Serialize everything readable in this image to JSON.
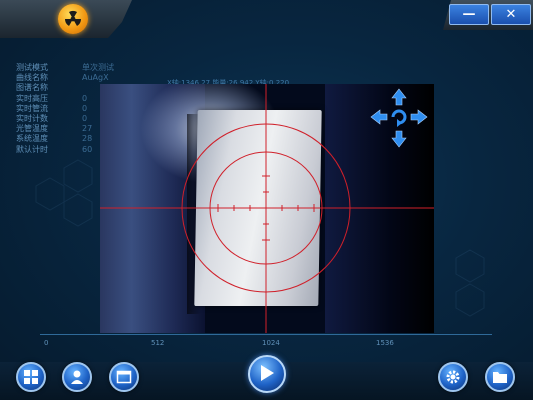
{
  "info_panel": [
    {
      "label": "测试模式",
      "value": "单次测试"
    },
    {
      "label": "曲线名称",
      "value": "AuAgX"
    },
    {
      "label": "图谱名称",
      "value": ""
    },
    {
      "label": "实时高压",
      "value": "0"
    },
    {
      "label": "实时管流",
      "value": "0"
    },
    {
      "label": "实时计数",
      "value": "0"
    },
    {
      "label": "光管温度",
      "value": "27"
    },
    {
      "label": "系统温度",
      "value": "28"
    },
    {
      "label": "默认计时",
      "value": "60"
    }
  ],
  "coordinate_readout": "X轴:1346.27  能量:26.942  Y轴:0.220",
  "scale": {
    "ticks": [
      "0",
      "512",
      "1024",
      "1536"
    ]
  },
  "window_buttons": {
    "minimize": "—",
    "close": "✕"
  },
  "icons": {
    "logo": "radiation-icon",
    "arrows": [
      "arrow-up-icon",
      "arrow-left-icon",
      "rotate-icon",
      "arrow-right-icon",
      "arrow-down-icon"
    ],
    "bottom": [
      "windows-icon",
      "user-icon",
      "window-icon",
      "play-icon",
      "settings-icon",
      "folder-icon"
    ]
  },
  "colors": {
    "crosshair": "#d0202a",
    "accent": "#2f7fe0"
  }
}
